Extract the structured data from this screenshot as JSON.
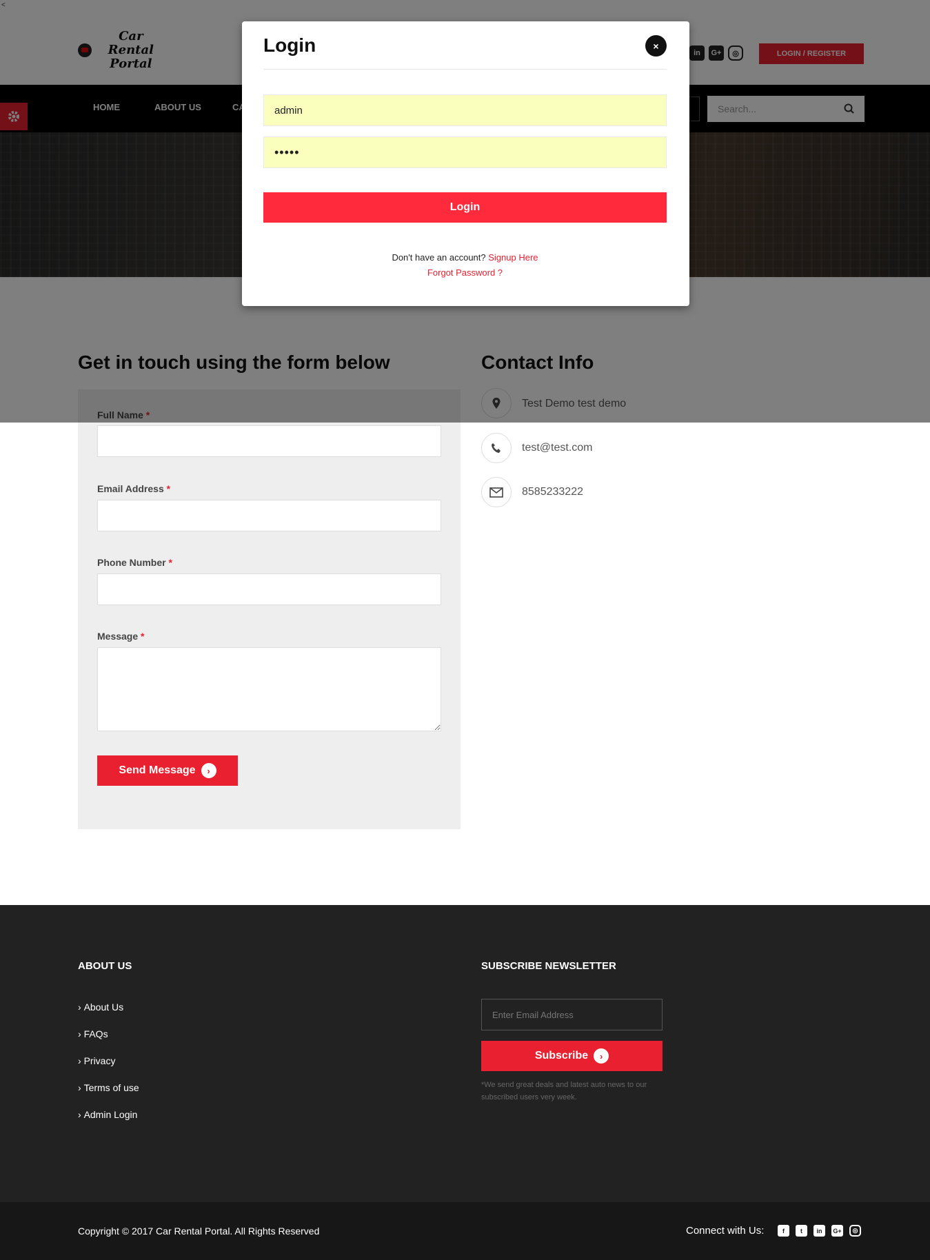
{
  "brand": {
    "logo_line1": "Car Rental",
    "logo_line2": "Portal"
  },
  "header": {
    "social": [
      "in",
      "G+",
      "◎"
    ],
    "login_register": "LOGIN / REGISTER",
    "accent_color": "#e8202f"
  },
  "nav": {
    "items": [
      "HOME",
      "ABOUT US",
      "CA"
    ],
    "search_placeholder": "Search..."
  },
  "contact_form": {
    "heading": "Get in touch using the form below",
    "fields": [
      {
        "label": "Full Name",
        "required": "*"
      },
      {
        "label": "Email Address",
        "required": "*"
      },
      {
        "label": "Phone Number",
        "required": "*"
      },
      {
        "label": "Message",
        "required": "*"
      }
    ],
    "submit": "Send Message"
  },
  "contact_info": {
    "heading": "Contact Info",
    "address": "Test Demo test demo",
    "email": "test@test.com",
    "phone": "8585233222"
  },
  "footer": {
    "about_heading": "ABOUT US",
    "links": [
      "About Us",
      "FAQs",
      "Privacy",
      "Terms of use",
      "Admin Login"
    ],
    "newsletter_heading": "SUBSCRIBE NEWSLETTER",
    "email_placeholder": "Enter Email Address",
    "subscribe": "Subscribe",
    "note": "*We send great deals and latest auto news to our subscribed users very week.",
    "copyright": "Copyright © 2017 Car Rental Portal. All Rights Reserved",
    "connect": "Connect with Us:",
    "social": [
      "f",
      "t",
      "in",
      "G+",
      "◎"
    ]
  },
  "modal": {
    "back": "<",
    "title": "Login",
    "close": "×",
    "username": "admin",
    "password": "•••••",
    "login_button": "Login",
    "no_account": "Don't have an account?",
    "signup": "Signup Here",
    "forgot": "Forgot Password ?"
  }
}
